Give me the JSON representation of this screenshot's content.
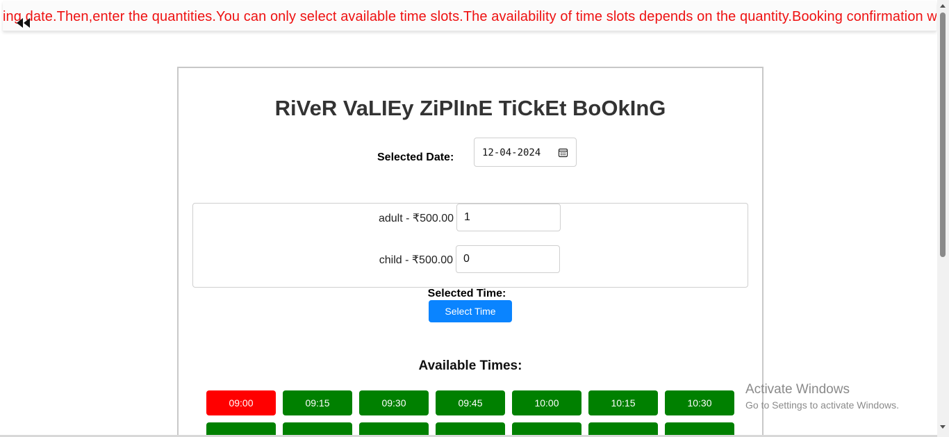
{
  "marquee": {
    "text": "ing date.Then,enter the quantities.You can only select available time slots.The availability of time slots depends on the quantity.Booking confirmation will"
  },
  "icons": {
    "back": "rewind-icon",
    "calendar": "calendar-icon"
  },
  "booking": {
    "title": "RiVeR VaLIEy ZiPlInE TiCkEt BoOkInG",
    "date_label": "Selected Date:",
    "date_value": "12-04-2024",
    "tickets": [
      {
        "label": "adult - ₹500.00",
        "value": "1"
      },
      {
        "label": "child - ₹500.00",
        "value": "0"
      }
    ],
    "selected_time_label": "Selected Time:",
    "select_time_button": "Select Time",
    "available_times_title": "Available Times:",
    "slots": [
      {
        "time": "09:00",
        "status": "unavailable"
      },
      {
        "time": "09:15",
        "status": "available"
      },
      {
        "time": "09:30",
        "status": "available"
      },
      {
        "time": "09:45",
        "status": "available"
      },
      {
        "time": "10:00",
        "status": "available"
      },
      {
        "time": "10:15",
        "status": "available"
      },
      {
        "time": "10:30",
        "status": "available"
      }
    ]
  },
  "colors": {
    "marquee_text": "#ee1111",
    "slot_available": "#008000",
    "slot_unavailable": "#ff0000",
    "select_button": "#0a84ff"
  },
  "watermark": {
    "title": "Activate Windows",
    "subtitle": "Go to Settings to activate Windows."
  }
}
